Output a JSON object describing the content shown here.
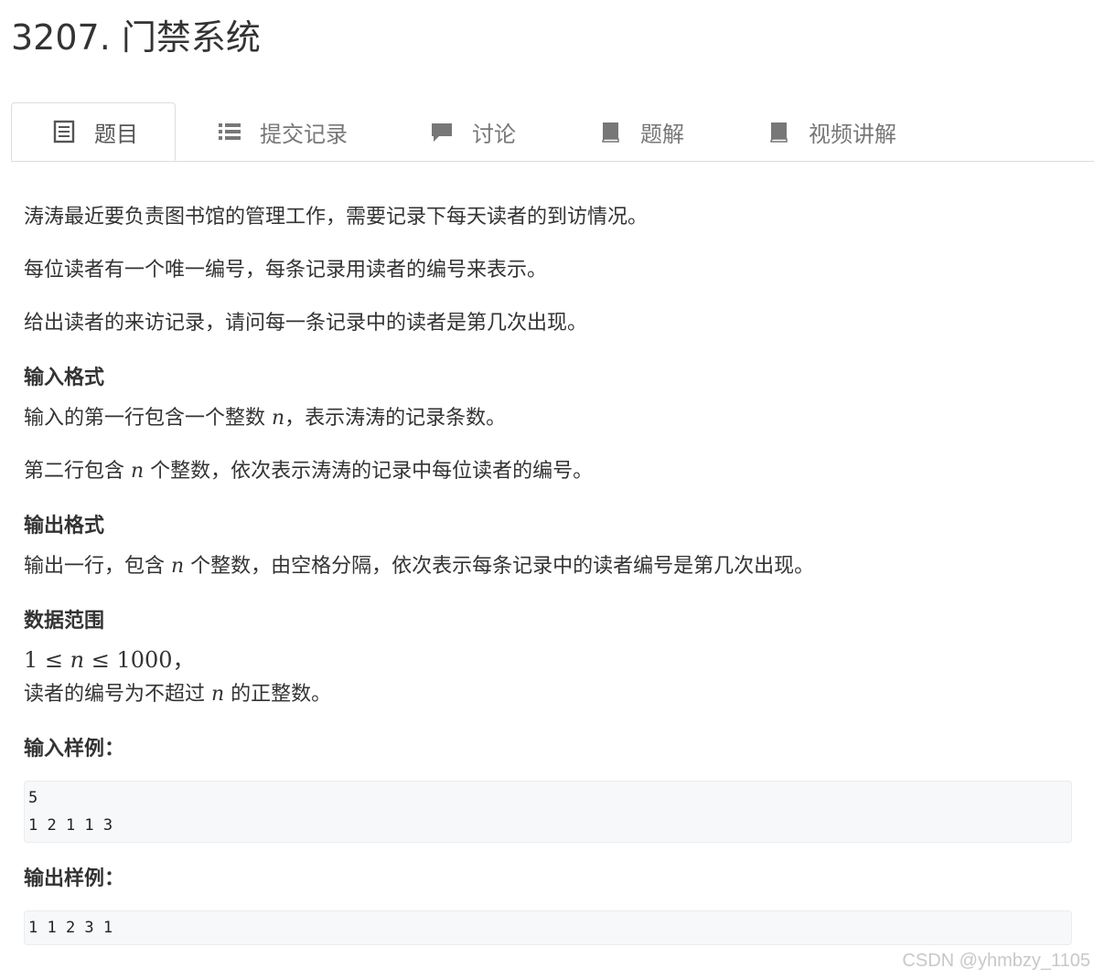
{
  "title": "3207. 门禁系统",
  "tabs": [
    {
      "label": "题目",
      "icon": "document-list-icon",
      "active": true
    },
    {
      "label": "提交记录",
      "icon": "list-icon",
      "active": false
    },
    {
      "label": "讨论",
      "icon": "comment-icon",
      "active": false
    },
    {
      "label": "题解",
      "icon": "book-icon",
      "active": false
    },
    {
      "label": "视频讲解",
      "icon": "book-icon",
      "active": false
    }
  ],
  "description": {
    "p1": "涛涛最近要负责图书馆的管理工作，需要记录下每天读者的到访情况。",
    "p2": "每位读者有一个唯一编号，每条记录用读者的编号来表示。",
    "p3": "给出读者的来访记录，请问每一条记录中的读者是第几次出现。"
  },
  "input_format": {
    "heading": "输入格式",
    "line1_pre": "输入的第一行包含一个整数 ",
    "var": "n",
    "line1_post": "，表示涛涛的记录条数。",
    "line2_pre": "第二行包含 ",
    "line2_post": " 个整数，依次表示涛涛的记录中每位读者的编号。"
  },
  "output_format": {
    "heading": "输出格式",
    "line_pre": "输出一行，包含 ",
    "line_post": " 个整数，由空格分隔，依次表示每条记录中的读者编号是第几次出现。"
  },
  "data_range": {
    "heading": "数据范围",
    "math_lo": "1 ≤ ",
    "math_hi": " ≤ 1000",
    "math_tail": "，",
    "line_pre": "读者的编号为不超过 ",
    "line_post": " 的正整数。"
  },
  "sample_input": {
    "heading": "输入样例：",
    "code": "5\n1 2 1 1 3"
  },
  "sample_output": {
    "heading": "输出样例：",
    "code": "1 1 2 3 1"
  },
  "watermark": "CSDN @yhmbzy_1105"
}
